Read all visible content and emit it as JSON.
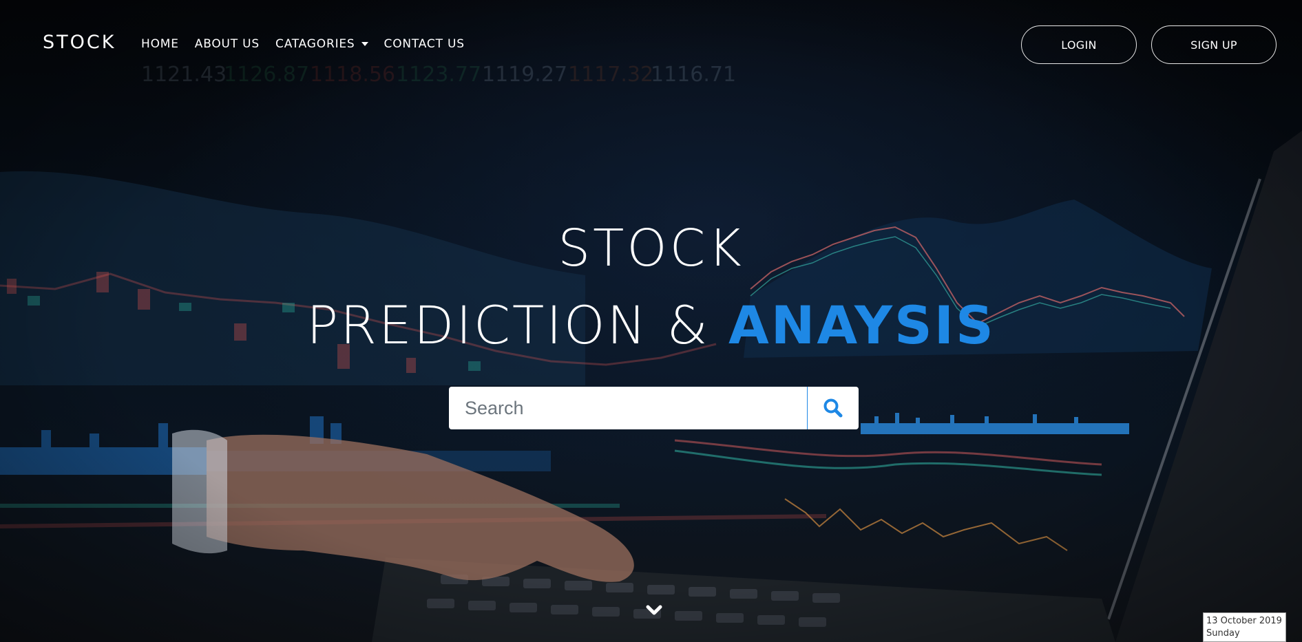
{
  "nav": {
    "brand": "STOCK",
    "items": [
      "HOME",
      "ABOUT US",
      "CATAGORIES",
      "CONTACT US"
    ],
    "login": "LOGIN",
    "signup": "SIGN UP"
  },
  "hero": {
    "title_line1": "STOCK",
    "title_line2_plain": "PREDICTION & ",
    "title_line2_accent": "ANAYSIS",
    "accent_color": "#1e88e5"
  },
  "search": {
    "placeholder": "Search",
    "icon": "search-icon"
  },
  "scroll_icon": "chevron-down-icon",
  "date_widget": {
    "date": "13 October 2019",
    "day": "Sunday"
  }
}
